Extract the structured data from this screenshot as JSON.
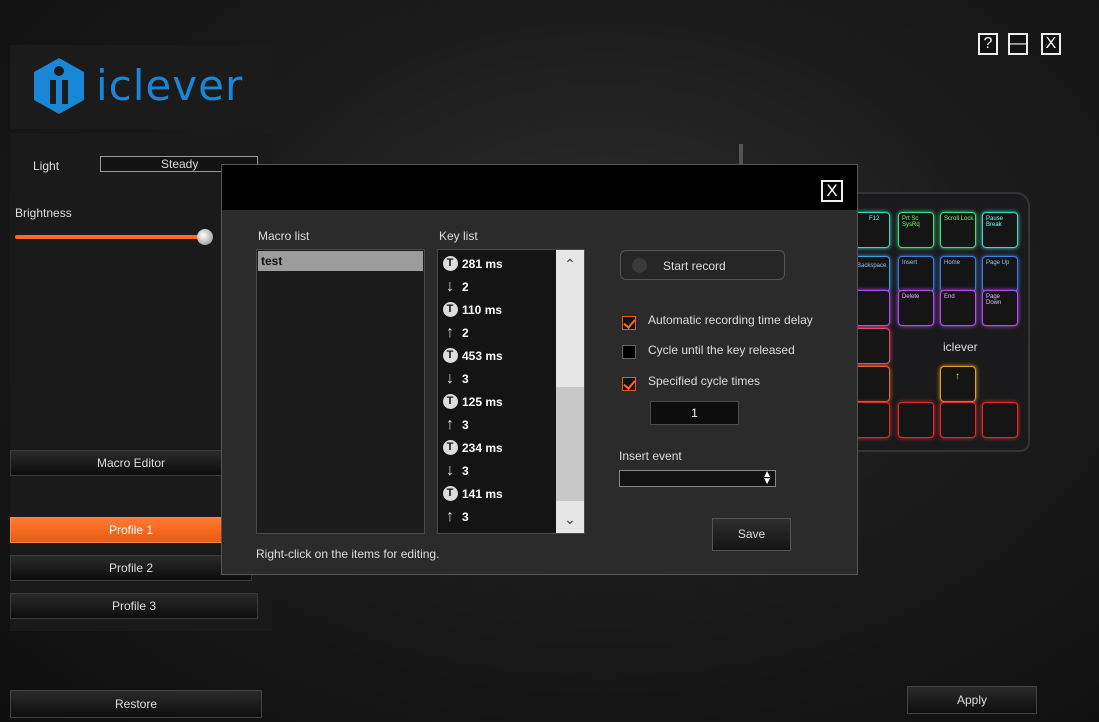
{
  "window_controls": {
    "help": "?",
    "minimize": "—",
    "close": "X"
  },
  "brand": {
    "name": "iclever"
  },
  "left": {
    "light_label": "Light",
    "light_value": "Steady",
    "brightness_label": "Brightness",
    "brightness_level": 1.0,
    "macro_editor": "Macro Editor",
    "profiles": [
      "Profile 1",
      "Profile 2",
      "Profile 3"
    ],
    "active_profile": "Profile 1"
  },
  "keyboard_preview": {
    "keys": [
      "F12",
      "Prt Sc SysRq",
      "Scroll Lock",
      "Pause Break",
      "Backspace",
      "Insert",
      "Home",
      "Page Up",
      "Delete",
      "End",
      "Page Down"
    ],
    "logo": "iclever",
    "arrow": "↑"
  },
  "dialog": {
    "close": "X",
    "macro_list_label": "Macro list",
    "key_list_label": "Key list",
    "macros": [
      "test"
    ],
    "keys": [
      {
        "icon": "T",
        "text": "281 ms"
      },
      {
        "icon": "↓",
        "text": "2"
      },
      {
        "icon": "T",
        "text": "110 ms"
      },
      {
        "icon": "↑",
        "text": "2"
      },
      {
        "icon": "T",
        "text": "453 ms"
      },
      {
        "icon": "↓",
        "text": "3"
      },
      {
        "icon": "T",
        "text": "125 ms"
      },
      {
        "icon": "↑",
        "text": "3"
      },
      {
        "icon": "T",
        "text": "234 ms"
      },
      {
        "icon": "↓",
        "text": "3"
      },
      {
        "icon": "T",
        "text": "141 ms"
      },
      {
        "icon": "↑",
        "text": "3"
      }
    ],
    "start_record": "Start record",
    "auto_delay": "Automatic recording time delay",
    "cycle_until_released": "Cycle until the key released",
    "specified_cycle": "Specified cycle times",
    "cycle_value": "1",
    "insert_event_label": "Insert event",
    "save": "Save",
    "hint": "Right-click on the items for editing."
  },
  "bottom": {
    "restore": "Restore",
    "apply": "Apply"
  },
  "colors": {
    "accent": "#ff6a1e",
    "dialog_bg": "#2b2b2b"
  }
}
